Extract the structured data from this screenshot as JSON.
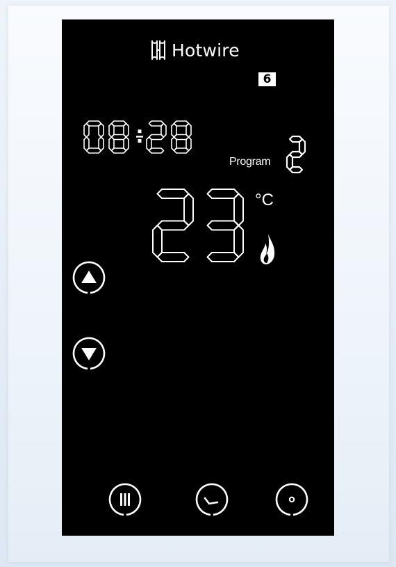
{
  "brand": {
    "name": "Hotwire",
    "logo_icon": "hotwire-logo-icon"
  },
  "badge": "6",
  "clock": {
    "time": "08:28"
  },
  "program": {
    "label": "Program",
    "number": "2"
  },
  "temperature": {
    "value": "23",
    "unit": "°C",
    "status_icon": "flame-icon"
  },
  "controls": {
    "up": "up-arrow-icon",
    "down": "down-arrow-icon",
    "menu": "menu-bars-icon",
    "clock": "clock-icon",
    "power": "power-dot-icon"
  },
  "colors": {
    "background": "#000000",
    "foreground": "#ffffff"
  }
}
